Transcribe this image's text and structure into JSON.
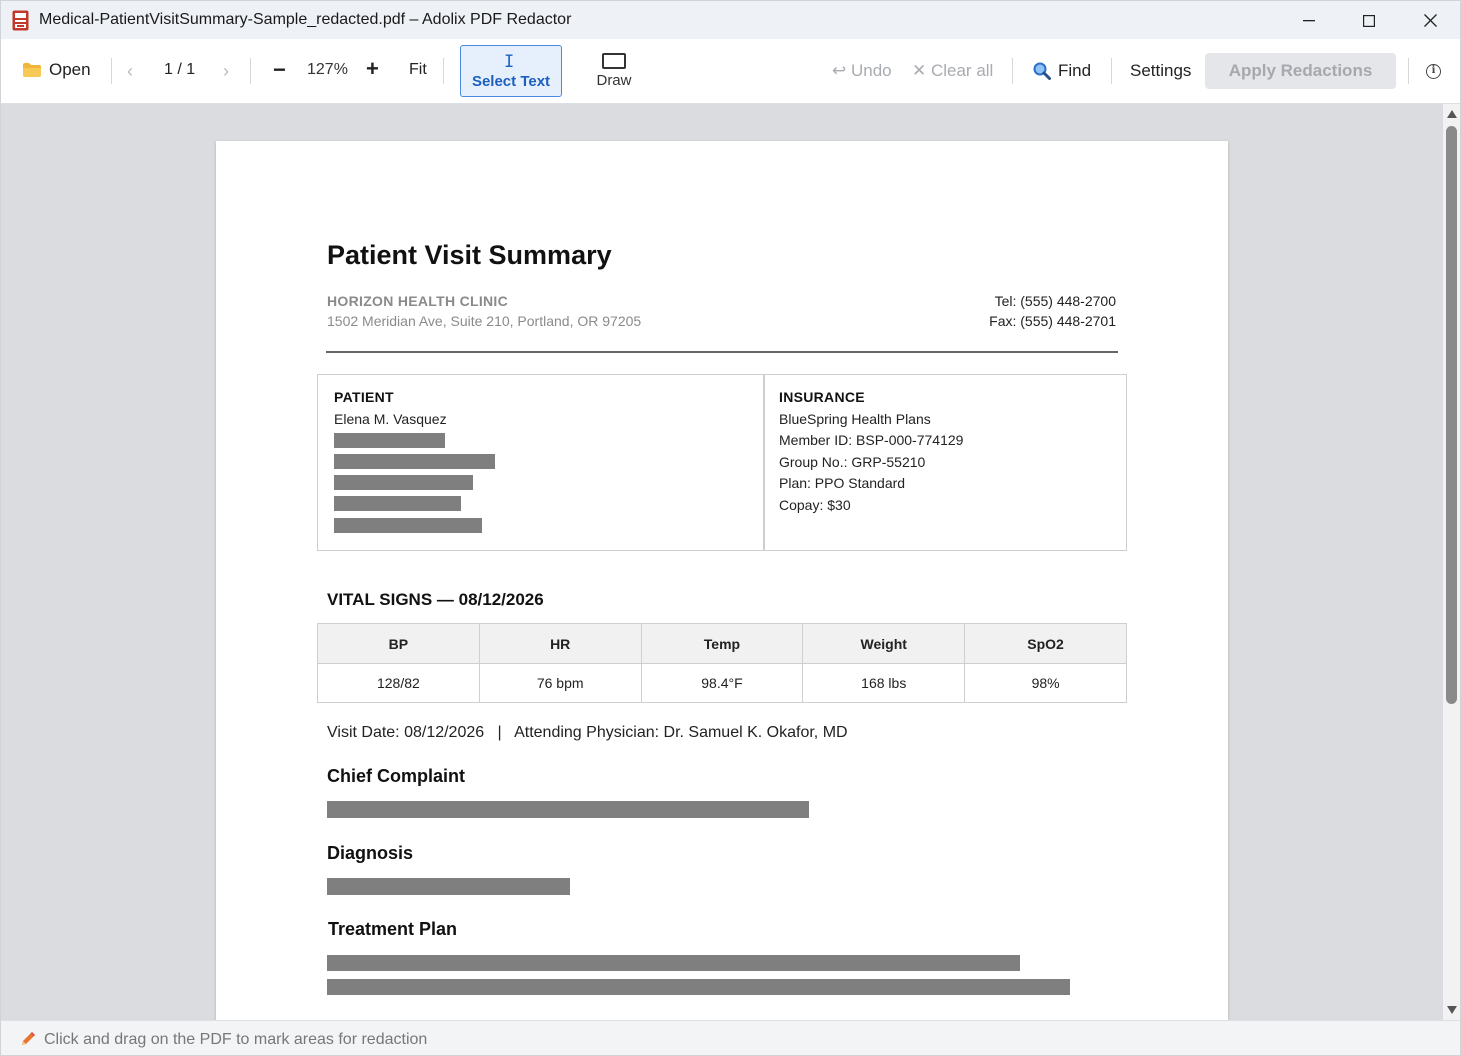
{
  "window": {
    "title": "Medical-PatientVisitSummary-Sample_redacted.pdf – Adolix PDF Redactor",
    "app_icon": "pdf-app-icon"
  },
  "toolbar": {
    "open_label": "Open",
    "prev_glyph": "‹",
    "page_indicator": "1 / 1",
    "next_glyph": "›",
    "zoom_out_glyph": "−",
    "zoom_level": "127%",
    "zoom_in_glyph": "+",
    "fit_label": "Fit",
    "select_text_label": "Select Text",
    "select_text_glyph": "I",
    "draw_label": "Draw",
    "undo_label": "↩ Undo",
    "clear_all_label": "✕ Clear all",
    "find_label": "Find",
    "settings_label": "Settings",
    "apply_label": "Apply Redactions",
    "info_glyph": "i",
    "active_tool": "Select Text",
    "accent_color": "#1d63c5"
  },
  "document": {
    "title": "Patient Visit Summary",
    "clinic": {
      "name": "HORIZON HEALTH CLINIC",
      "address": "1502 Meridian Ave, Suite 210, Portland, OR 97205",
      "tel": "Tel: (555) 448-2700",
      "fax": "Fax: (555) 448-2701"
    },
    "patient": {
      "heading": "PATIENT",
      "name": "Elena M. Vasquez",
      "redacted_lines": 5
    },
    "insurance": {
      "heading": "INSURANCE",
      "lines": [
        "BlueSpring Health Plans",
        "Member ID: BSP-000-774129",
        "Group No.: GRP-55210",
        "Plan: PPO Standard",
        "Copay: $30"
      ]
    },
    "vitals": {
      "title": "VITAL SIGNS — 08/12/2026",
      "headers": [
        "BP",
        "HR",
        "Temp",
        "Weight",
        "SpO2"
      ],
      "values": [
        "128/82",
        "76 bpm",
        "98.4°F",
        "168 lbs",
        "98%"
      ]
    },
    "visit_line": "Visit Date: 08/12/2026   |   Attending Physician: Dr. Samuel K. Okafor, MD",
    "sections": {
      "chief_complaint": "Chief Complaint",
      "diagnosis": "Diagnosis",
      "treatment_plan": "Treatment Plan"
    },
    "redaction_color": "#7f7f7f"
  },
  "statusbar": {
    "icon": "pencil-icon",
    "text": "Click and drag on the PDF to mark areas for redaction"
  }
}
